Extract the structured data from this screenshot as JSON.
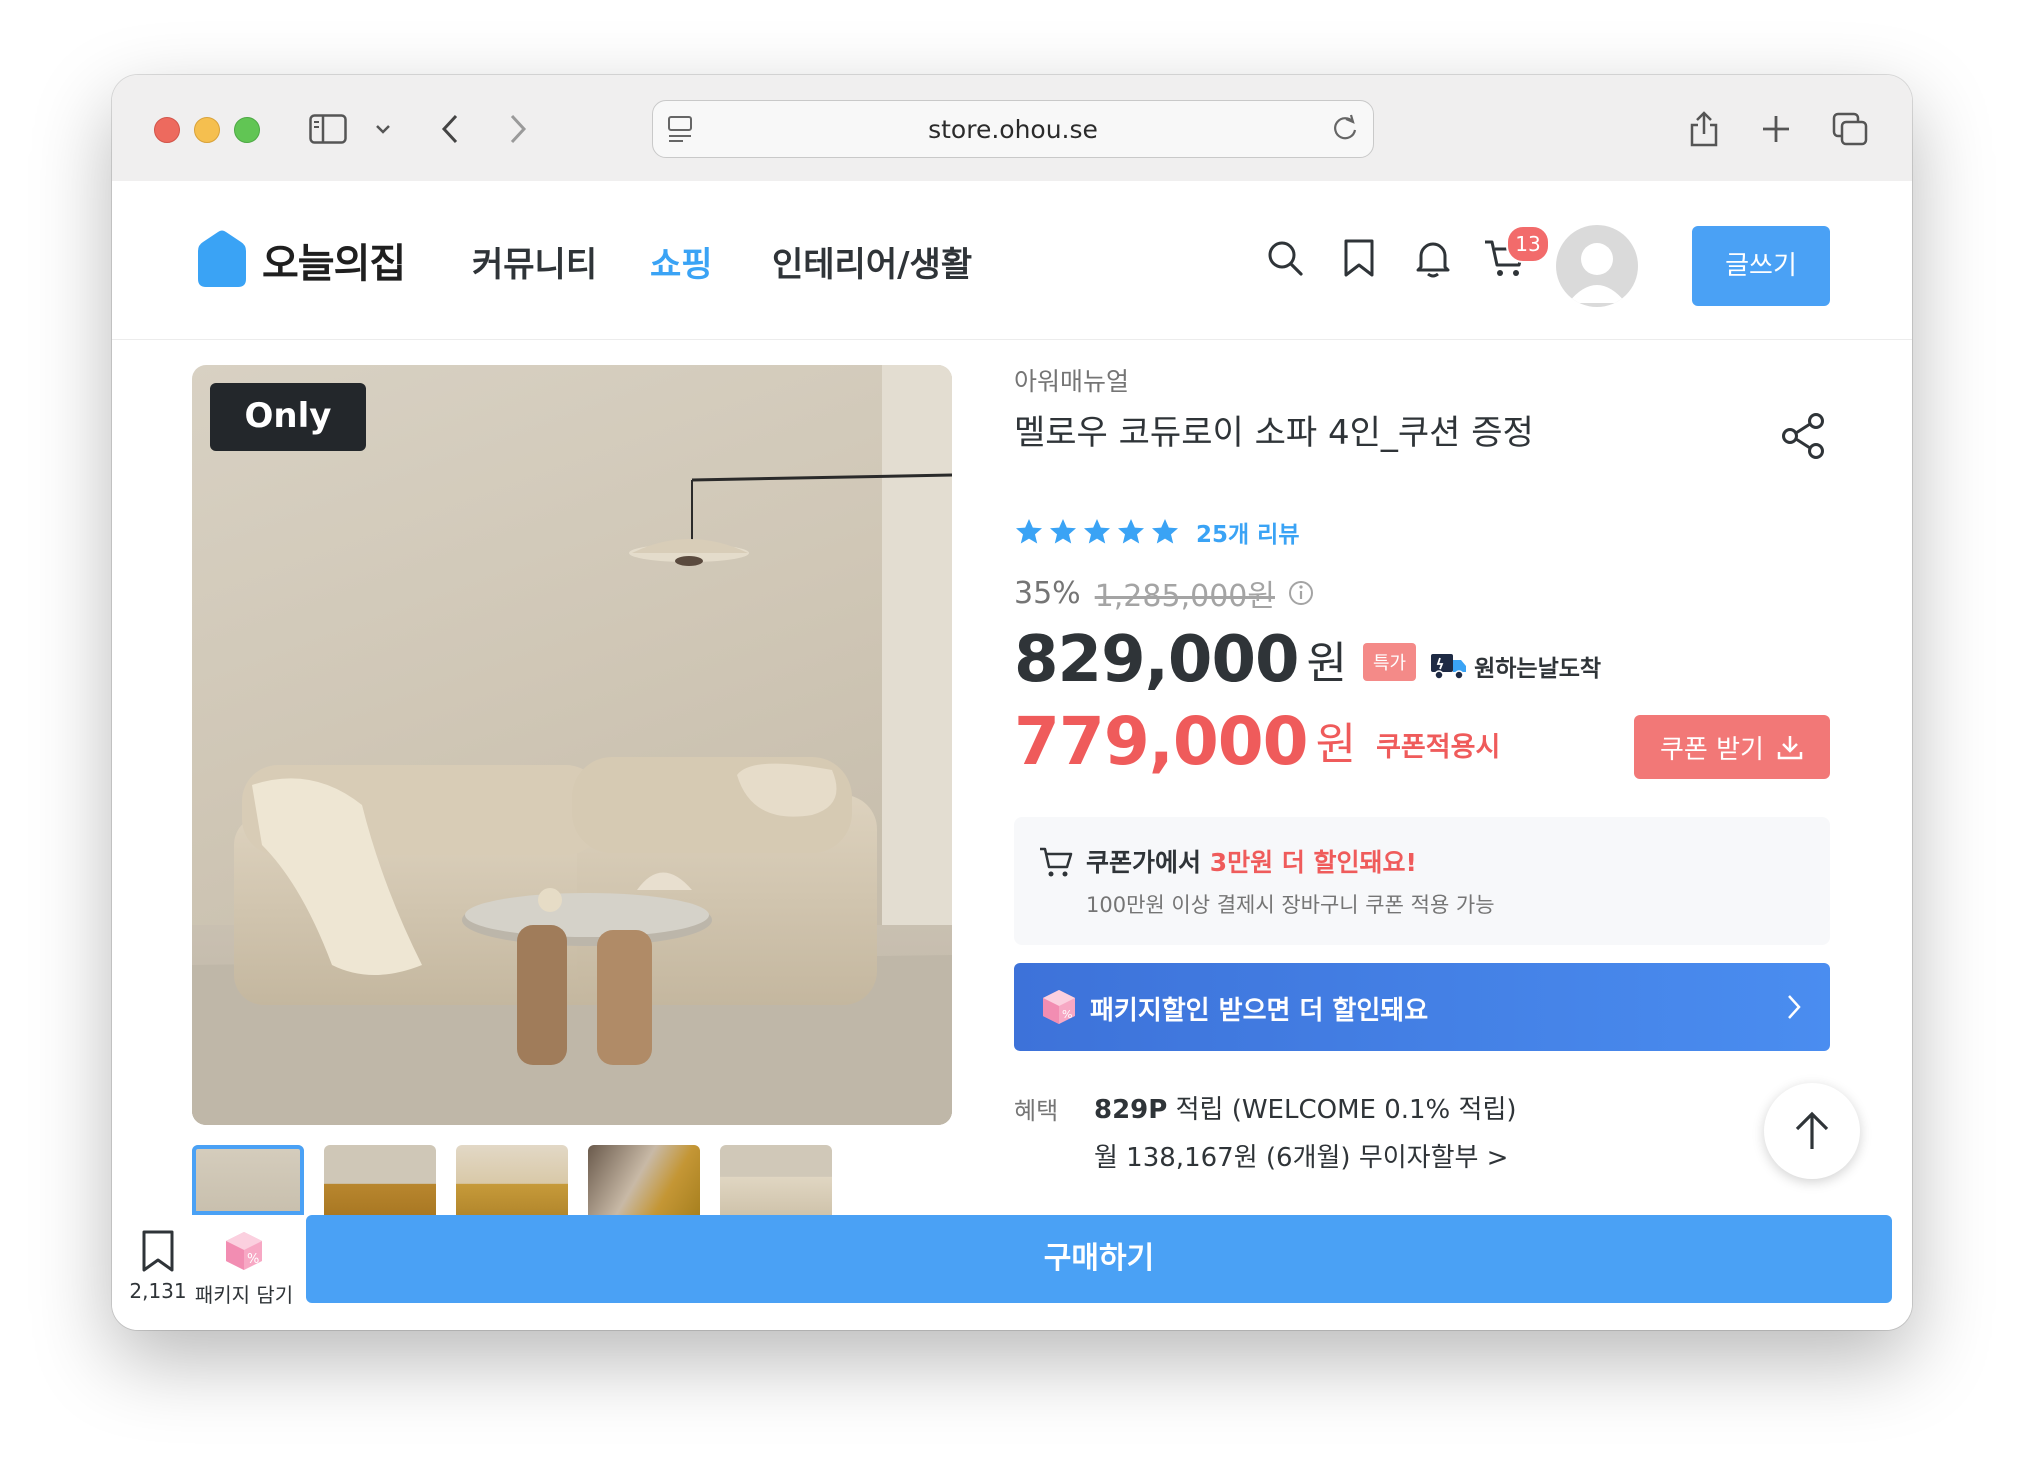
{
  "browser": {
    "url": "store.ohou.se"
  },
  "header": {
    "logo_text": "오늘의집",
    "nav": [
      "커뮤니티",
      "쇼핑",
      "인테리어/생활"
    ],
    "active_nav": "쇼핑",
    "cart_count": "13",
    "write_button": "글쓰기",
    "accent_color": "#3aa3f5"
  },
  "product": {
    "badge": "Only",
    "brand": "아워매뉴얼",
    "title": "멜로우 코듀로이 소파 4인_쿠션 증정",
    "rating": 5,
    "review_text": "25개 리뷰",
    "discount_rate": "35%",
    "original_price": "1,285,000원",
    "price": "829,000",
    "price_unit": "원",
    "special_badge": "특가",
    "arrival_badge": "원하는날도착",
    "coupon_price": "779,000",
    "coupon_unit": "원",
    "coupon_apply": "쿠폰적용시",
    "coupon_button": "쿠폰 받기"
  },
  "coupon_info": {
    "line1_prefix": "쿠폰가에서 ",
    "line1_highlight": "3만원 더 할인돼요!",
    "line2": "100만원 이상 결제시 장바구니 쿠폰 적용 가능"
  },
  "package_bar": {
    "text": "패키지할인 받으면 더 할인돼요"
  },
  "benefit": {
    "label": "혜택",
    "points": "829P",
    "points_suffix": " 적립 (WELCOME 0.1% 적립)",
    "installment": "월 138,167원 (6개월) 무이자할부 >"
  },
  "bottom_bar": {
    "bookmark_count": "2,131",
    "package_label": "패키지 담기",
    "buy_button": "구매하기"
  }
}
